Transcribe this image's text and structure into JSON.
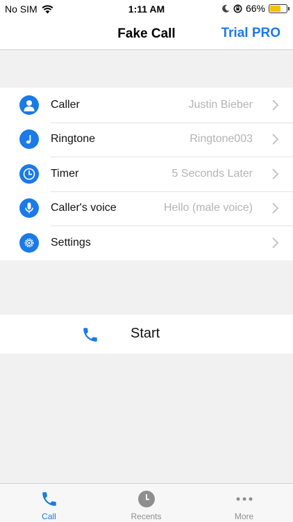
{
  "status_bar": {
    "carrier": "No SIM",
    "time": "1:11 AM",
    "battery_percent": "66%",
    "battery_level": 0.66
  },
  "nav": {
    "title": "Fake Call",
    "right_button": "Trial PRO"
  },
  "settings": [
    {
      "label": "Caller",
      "value": "Justin Bieber",
      "icon": "person-icon"
    },
    {
      "label": "Ringtone",
      "value": "Ringtone003",
      "icon": "music-note-icon"
    },
    {
      "label": "Timer",
      "value": "5 Seconds Later",
      "icon": "clock-icon"
    },
    {
      "label": "Caller's voice",
      "value": "Hello (male voice)",
      "icon": "microphone-icon"
    },
    {
      "label": "Settings",
      "value": "",
      "icon": "gear-icon"
    }
  ],
  "start": {
    "label": "Start",
    "icon": "phone-icon"
  },
  "tabs": [
    {
      "label": "Call",
      "icon": "phone-icon",
      "active": true
    },
    {
      "label": "Recents",
      "icon": "clock-icon",
      "active": false
    },
    {
      "label": "More",
      "icon": "more-dots-icon",
      "active": false
    }
  ],
  "colors": {
    "accent": "#1a7ae8",
    "value_text": "#b4b4b4",
    "background": "#f1f1f1",
    "battery": "#f6c300"
  }
}
